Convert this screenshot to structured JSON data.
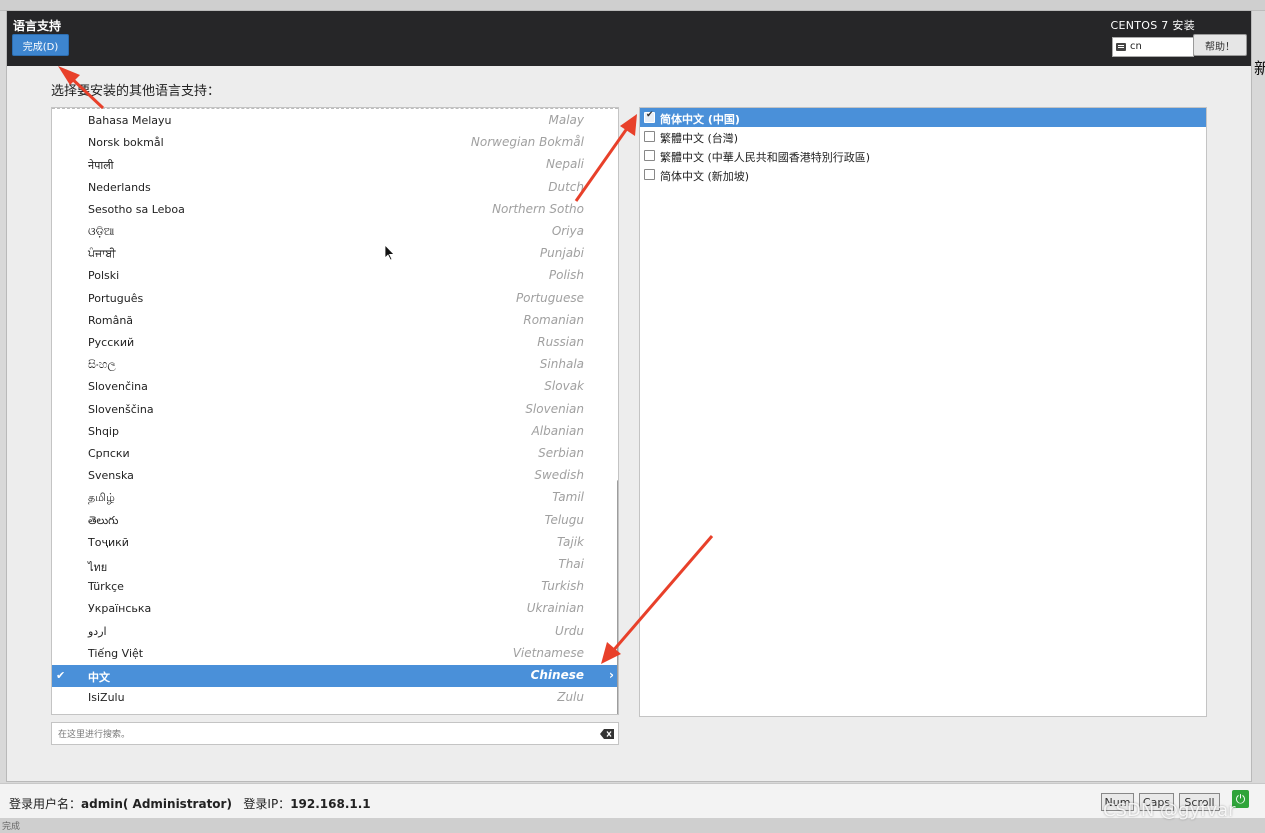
{
  "window": {
    "title": "语言支持",
    "done_label": "完成(D)",
    "product_title": "CENTOS 7 安装",
    "keyboard_layout": "cn",
    "help_label": "帮助！"
  },
  "prompt": "选择要安装的其他语言支持：",
  "languages": [
    {
      "native": "Bahasa Melayu",
      "english": "Malay"
    },
    {
      "native": "Norsk bokmål",
      "english": "Norwegian Bokmål"
    },
    {
      "native": "नेपाली",
      "english": "Nepali"
    },
    {
      "native": "Nederlands",
      "english": "Dutch"
    },
    {
      "native": "Sesotho sa Leboa",
      "english": "Northern Sotho"
    },
    {
      "native": "ଓଡ଼ିଆ",
      "english": "Oriya"
    },
    {
      "native": "ਪੰਜਾਬੀ",
      "english": "Punjabi"
    },
    {
      "native": "Polski",
      "english": "Polish"
    },
    {
      "native": "Português",
      "english": "Portuguese"
    },
    {
      "native": "Română",
      "english": "Romanian"
    },
    {
      "native": "Русский",
      "english": "Russian"
    },
    {
      "native": "සිංහල",
      "english": "Sinhala"
    },
    {
      "native": "Slovenčina",
      "english": "Slovak"
    },
    {
      "native": "Slovenščina",
      "english": "Slovenian"
    },
    {
      "native": "Shqip",
      "english": "Albanian"
    },
    {
      "native": "Српски",
      "english": "Serbian"
    },
    {
      "native": "Svenska",
      "english": "Swedish"
    },
    {
      "native": "தமிழ்",
      "english": "Tamil"
    },
    {
      "native": "తెలుగు",
      "english": "Telugu"
    },
    {
      "native": "Тоҷикӣ",
      "english": "Tajik"
    },
    {
      "native": "ไทย",
      "english": "Thai"
    },
    {
      "native": "Türkçe",
      "english": "Turkish"
    },
    {
      "native": "Українська",
      "english": "Ukrainian"
    },
    {
      "native": "اردو",
      "english": "Urdu"
    },
    {
      "native": "Tiếng Việt",
      "english": "Vietnamese"
    },
    {
      "native": "中文",
      "english": "Chinese",
      "selected": true
    },
    {
      "native": "IsiZulu",
      "english": "Zulu"
    }
  ],
  "search": {
    "placeholder": "在这里进行搜索。"
  },
  "locales": [
    {
      "label": "简体中文 (中国)",
      "checked": true,
      "selected": true
    },
    {
      "label": "繁體中文 (台灣)",
      "checked": false
    },
    {
      "label": "繁體中文 (中華人民共和國香港特別行政區)",
      "checked": false
    },
    {
      "label": "简体中文 (新加坡)",
      "checked": false
    }
  ],
  "status": {
    "user_label": "登录用户名：",
    "user_value": "admin( Administrator)",
    "ip_label": "登录IP：",
    "ip_value": "192.168.1.1",
    "num": "Num",
    "caps": "Caps",
    "scroll": "Scroll"
  },
  "bottom_text": "完成",
  "watermark": "CSDN @gyfvar",
  "colors": {
    "selection": "#4a90d9",
    "header": "#262628",
    "done_button": "#3d85cf",
    "arrow": "#e8402a"
  }
}
